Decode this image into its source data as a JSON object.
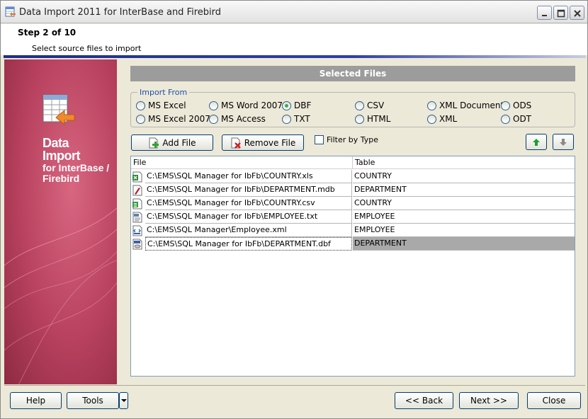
{
  "window": {
    "title": "Data Import 2011 for InterBase and Firebird"
  },
  "header": {
    "step": "Step 2 of 10",
    "subtitle": "Select source files to import"
  },
  "side": {
    "title_line1": "Data",
    "title_line2": "Import",
    "title_line3": "for InterBase / Firebird"
  },
  "selected_files_title": "Selected Files",
  "import_from": {
    "label": "Import From",
    "selected": "DBF",
    "options": [
      "MS Excel",
      "MS Excel 2007",
      "MS Word 2007",
      "MS Access",
      "DBF",
      "TXT",
      "CSV",
      "HTML",
      "XML Document",
      "XML",
      "ODS",
      "ODT"
    ]
  },
  "toolbar": {
    "add_file": "Add File",
    "remove_file": "Remove File",
    "filter_by_type": "Filter by Type"
  },
  "files_table": {
    "columns": [
      "File",
      "Table"
    ],
    "rows": [
      {
        "file": "C:\\EMS\\SQL Manager for IbFb\\COUNTRY.xls",
        "table": "COUNTRY",
        "icon": "excel-file-icon"
      },
      {
        "file": "C:\\EMS\\SQL Manager for IbFb\\DEPARTMENT.mdb",
        "table": "DEPARTMENT",
        "icon": "access-file-icon"
      },
      {
        "file": "C:\\EMS\\SQL Manager for IbFb\\COUNTRY.csv",
        "table": "COUNTRY",
        "icon": "csv-file-icon"
      },
      {
        "file": "C:\\EMS\\SQL Manager for IbFb\\EMPLOYEE.txt",
        "table": "EMPLOYEE",
        "icon": "txt-file-icon"
      },
      {
        "file": "C:\\EMS\\SQL Manager\\Employee.xml",
        "table": "EMPLOYEE",
        "icon": "xml-file-icon"
      },
      {
        "file": "C:\\EMS\\SQL Manager for IbFb\\DEPARTMENT.dbf",
        "table": "DEPARTMENT",
        "icon": "dbf-file-icon"
      }
    ]
  },
  "footer": {
    "help": "Help",
    "tools": "Tools",
    "back": "<< Back",
    "next": "Next >>",
    "close": "Close"
  }
}
